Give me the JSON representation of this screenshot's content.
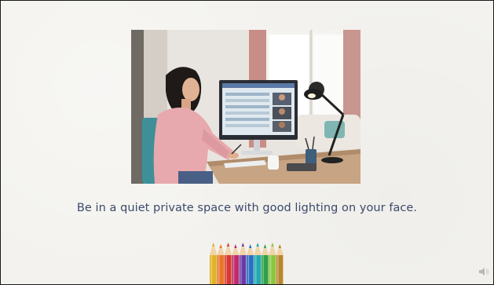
{
  "slide": {
    "caption": "Be in a quiet private space with good lighting on your face.",
    "photo": {
      "subject": "woman at desk on video call with desk lamp"
    },
    "decoration": {
      "icon": "colored-pencils-icon",
      "pencil_colors": [
        "#e0b228",
        "#e8752a",
        "#d63a2f",
        "#c22b6a",
        "#6a3aa8",
        "#2b6fc4",
        "#21a8b0",
        "#2fa04a",
        "#8bc63f",
        "#b8862b"
      ]
    },
    "audio_icon": "speaker-icon"
  },
  "colors": {
    "background": "#f3f2ee",
    "caption_text": "#3b4a6b",
    "border": "#1a1a1a"
  }
}
